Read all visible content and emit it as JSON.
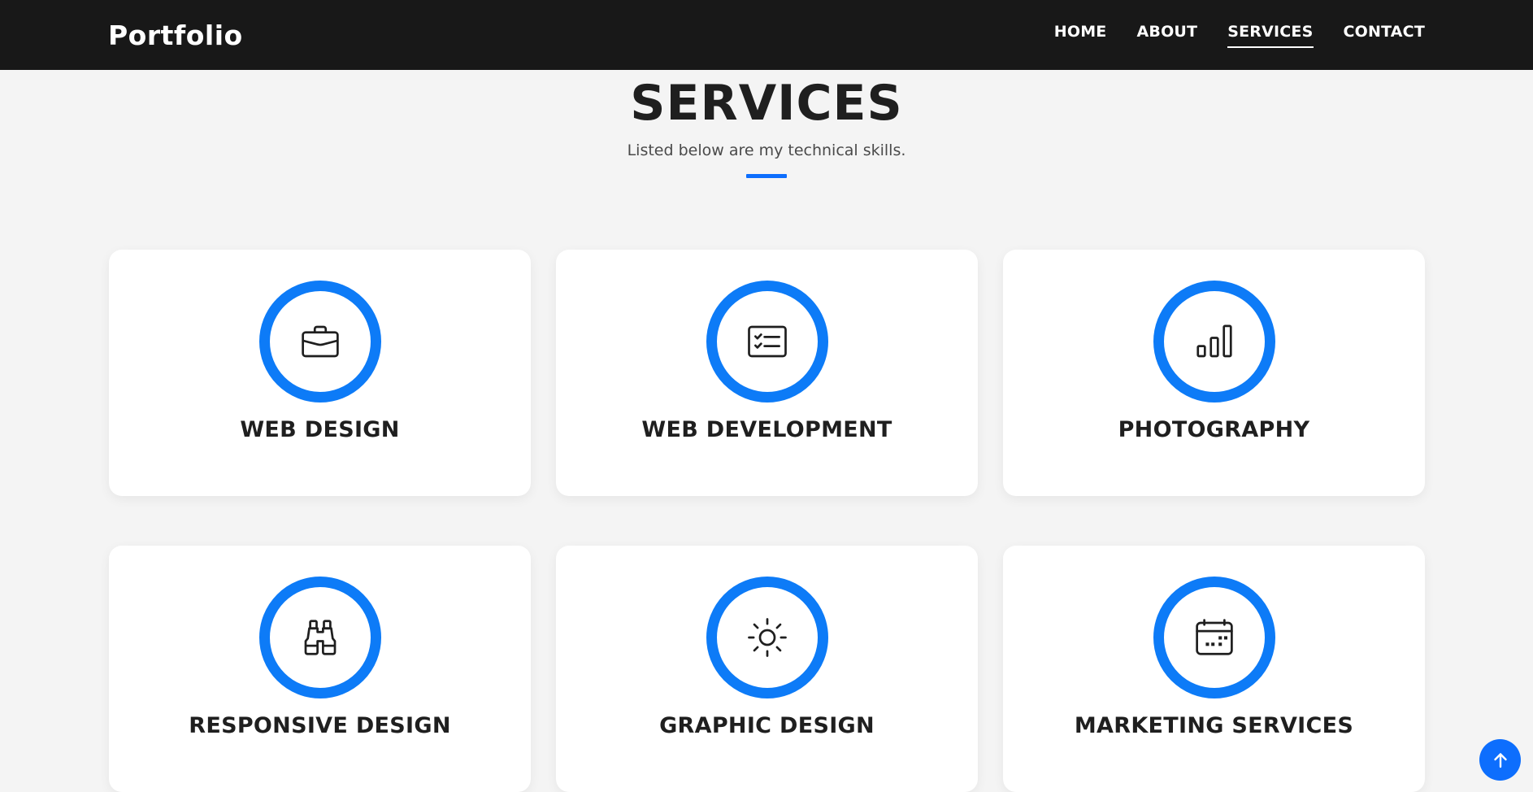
{
  "navbar": {
    "brand": "Portfolio",
    "links": [
      {
        "label": "HOME",
        "active": false
      },
      {
        "label": "ABOUT",
        "active": false
      },
      {
        "label": "SERVICES",
        "active": true
      },
      {
        "label": "CONTACT",
        "active": false
      }
    ]
  },
  "section": {
    "title": "SERVICES",
    "subtitle": "Listed below are my technical skills."
  },
  "services": [
    {
      "title": "WEB DESIGN",
      "icon": "briefcase-icon"
    },
    {
      "title": "WEB DEVELOPMENT",
      "icon": "card-checklist-icon"
    },
    {
      "title": "PHOTOGRAPHY",
      "icon": "bar-chart-icon"
    },
    {
      "title": "RESPONSIVE DESIGN",
      "icon": "binoculars-icon"
    },
    {
      "title": "GRAPHIC DESIGN",
      "icon": "sun-icon"
    },
    {
      "title": "MARKETING SERVICES",
      "icon": "calendar-icon"
    }
  ],
  "back_to_top": {
    "icon": "arrow-up-icon"
  },
  "colors": {
    "navbar_bg": "#181818",
    "accent": "#0d7bf7",
    "page_bg": "#f4f4f4",
    "card_bg": "#ffffff"
  }
}
